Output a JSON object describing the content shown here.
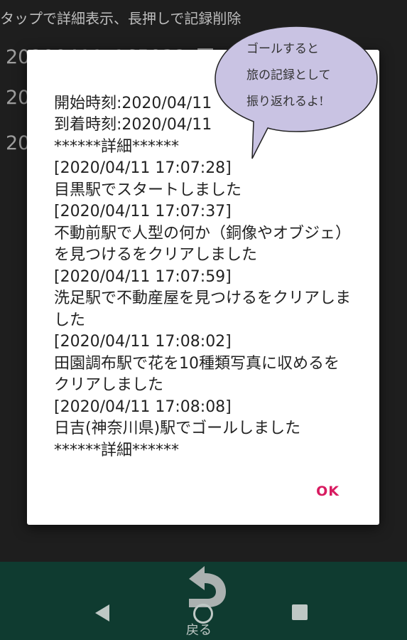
{
  "background": {
    "hint": "タップで詳細表示、長押しで記録削除",
    "rows": [
      "20200411_165032_田",
      "20",
      "20"
    ]
  },
  "dialog": {
    "lines": [
      "開始時刻:2020/04/11",
      "到着時刻:2020/04/11",
      "******詳細******",
      "[2020/04/11 17:07:28]",
      "目黒駅でスタートしました",
      "[2020/04/11 17:07:37]",
      "不動前駅で人型の何か（銅像やオブジェ）を見つけるをクリアしました",
      "[2020/04/11 17:07:59]",
      "洗足駅で不動産屋を見つけるをクリアしました",
      "[2020/04/11 17:08:02]",
      "田園調布駅で花を10種類写真に収めるをクリアしました",
      "[2020/04/11 17:08:08]",
      "日吉(神奈川県)駅でゴールしました",
      "******詳細******"
    ],
    "ok_label": "OK"
  },
  "balloon": {
    "lines": [
      "ゴールすると",
      "旅の記録として",
      "振り返れるよ!"
    ],
    "fill": "#c9c3e3"
  },
  "navbar": {
    "return_label": "戻る",
    "color": "#0f3b30"
  },
  "colors": {
    "accent": "#d81b60",
    "dialog_bg": "#ffffff",
    "screen_bg": "#1e1e1e"
  }
}
